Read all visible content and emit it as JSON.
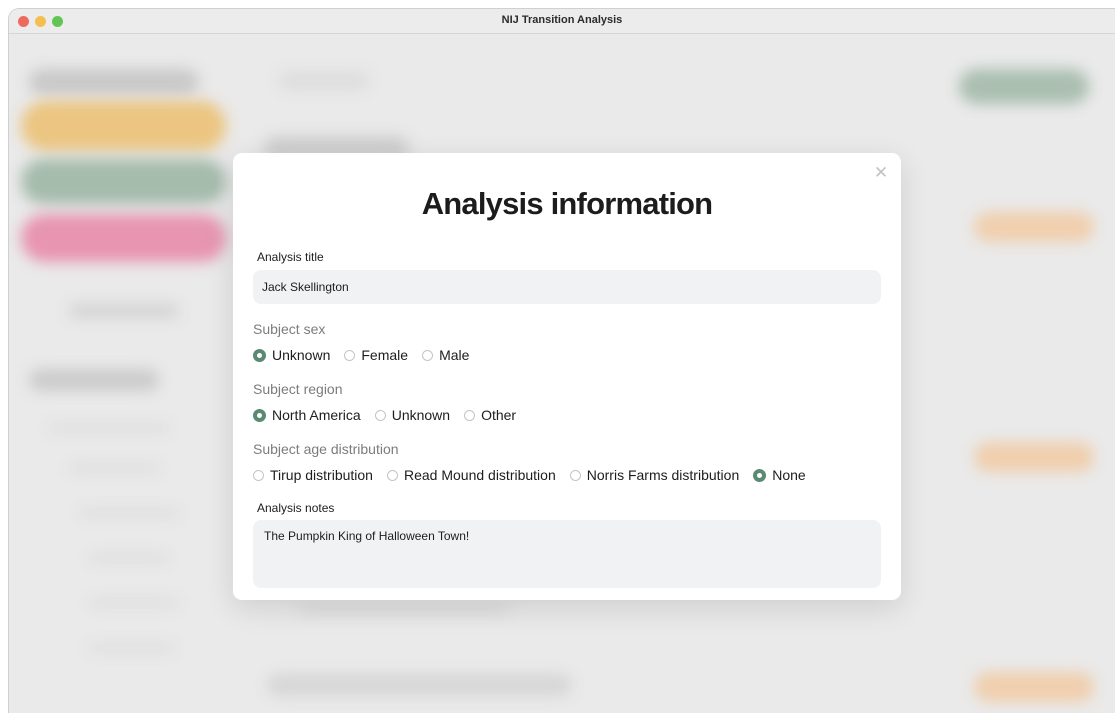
{
  "window": {
    "title": "NIJ Transition Analysis"
  },
  "modal": {
    "heading": "Analysis information",
    "close_icon": "close-icon",
    "title_field": {
      "label": "Analysis title",
      "value": "Jack Skellington"
    },
    "subject_sex": {
      "label": "Subject sex",
      "options": [
        "Unknown",
        "Female",
        "Male"
      ],
      "selected": "Unknown"
    },
    "subject_region": {
      "label": "Subject region",
      "options": [
        "North America",
        "Unknown",
        "Other"
      ],
      "selected": "North America"
    },
    "age_distribution": {
      "label": "Subject age distribution",
      "options": [
        "Tirup distribution",
        "Read Mound distribution",
        "Norris Farms distribution",
        "None"
      ],
      "selected": "None"
    },
    "notes_field": {
      "label": "Analysis notes",
      "value": "The Pumpkin King of Halloween Town!"
    }
  },
  "colors": {
    "accent_green": "#5b8a72",
    "sidebar_orange": "#e9ae45",
    "sidebar_green": "#7d9f88",
    "sidebar_pink": "#e2648f",
    "button_orange": "#f0bd8a"
  }
}
